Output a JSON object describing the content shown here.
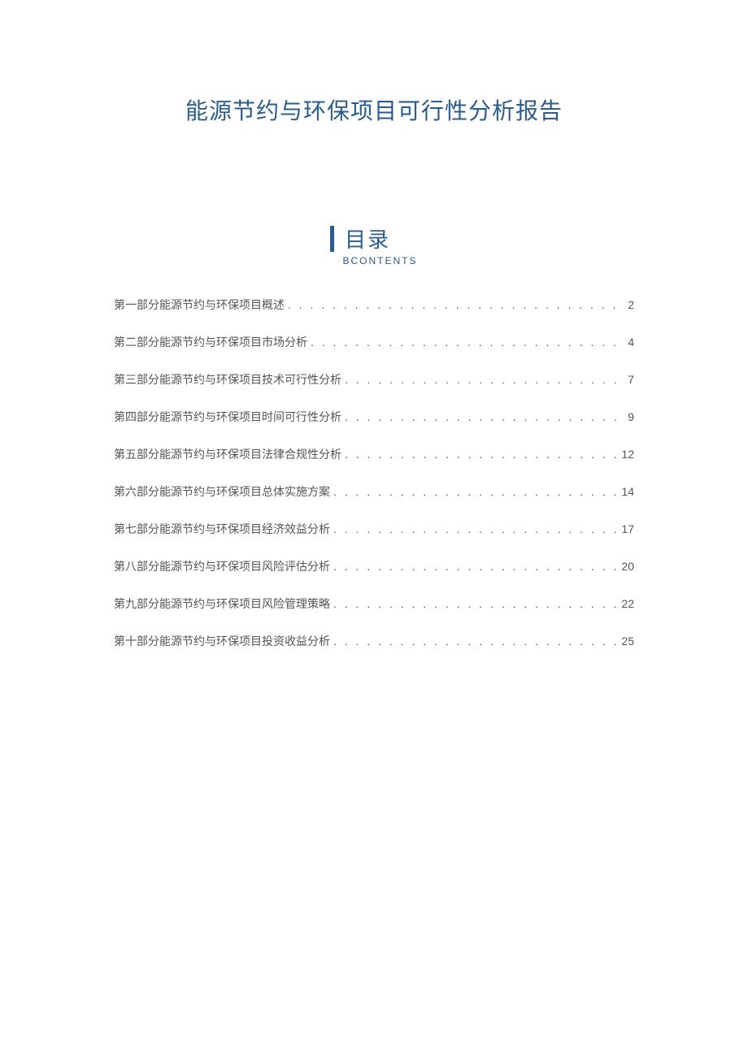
{
  "title": "能源节约与环保项目可行性分析报告",
  "toc": {
    "heading": "目录",
    "subheading": "BCONTENTS",
    "entries": [
      {
        "title": "第一部分能源节约与环保项目概述",
        "page": "2"
      },
      {
        "title": "第二部分能源节约与环保项目市场分析",
        "page": "4"
      },
      {
        "title": "第三部分能源节约与环保项目技术可行性分析",
        "page": "7"
      },
      {
        "title": "第四部分能源节约与环保项目时间可行性分析",
        "page": "9"
      },
      {
        "title": "第五部分能源节约与环保项目法律合规性分析",
        "page": "12"
      },
      {
        "title": "第六部分能源节约与环保项目总体实施方案",
        "page": "14"
      },
      {
        "title": "第七部分能源节约与环保项目经济效益分析",
        "page": "17"
      },
      {
        "title": "第八部分能源节约与环保项目风险评估分析",
        "page": "20"
      },
      {
        "title": "第九部分能源节约与环保项目风险管理策略",
        "page": "22"
      },
      {
        "title": "第十部分能源节约与环保项目投资收益分析",
        "page": "25"
      }
    ]
  }
}
